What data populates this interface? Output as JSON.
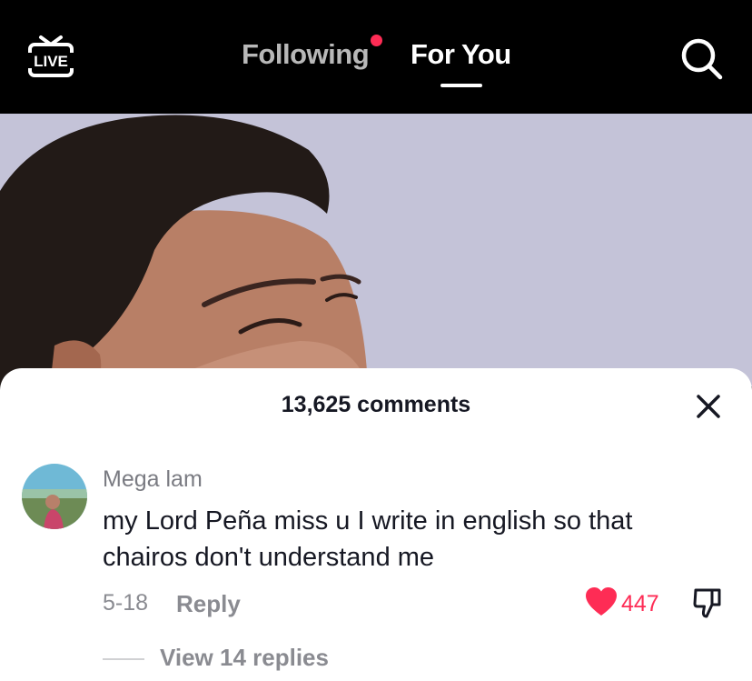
{
  "header": {
    "live_label": "LIVE",
    "tabs": [
      {
        "label": "Following",
        "has_notification": true,
        "active": false
      },
      {
        "label": "For You",
        "active": true
      }
    ]
  },
  "comments_panel": {
    "count_label": "13,625 comments",
    "comment": {
      "username": "Mega lam",
      "text": "my Lord Peña miss u I write in english so that chairos don't understand me",
      "date": "5-18",
      "reply_label": "Reply",
      "likes": "447",
      "view_replies_label": "View 14 replies"
    }
  },
  "colors": {
    "accent": "#fe2c55",
    "text_primary": "#161823",
    "text_secondary": "#8a8b91"
  }
}
